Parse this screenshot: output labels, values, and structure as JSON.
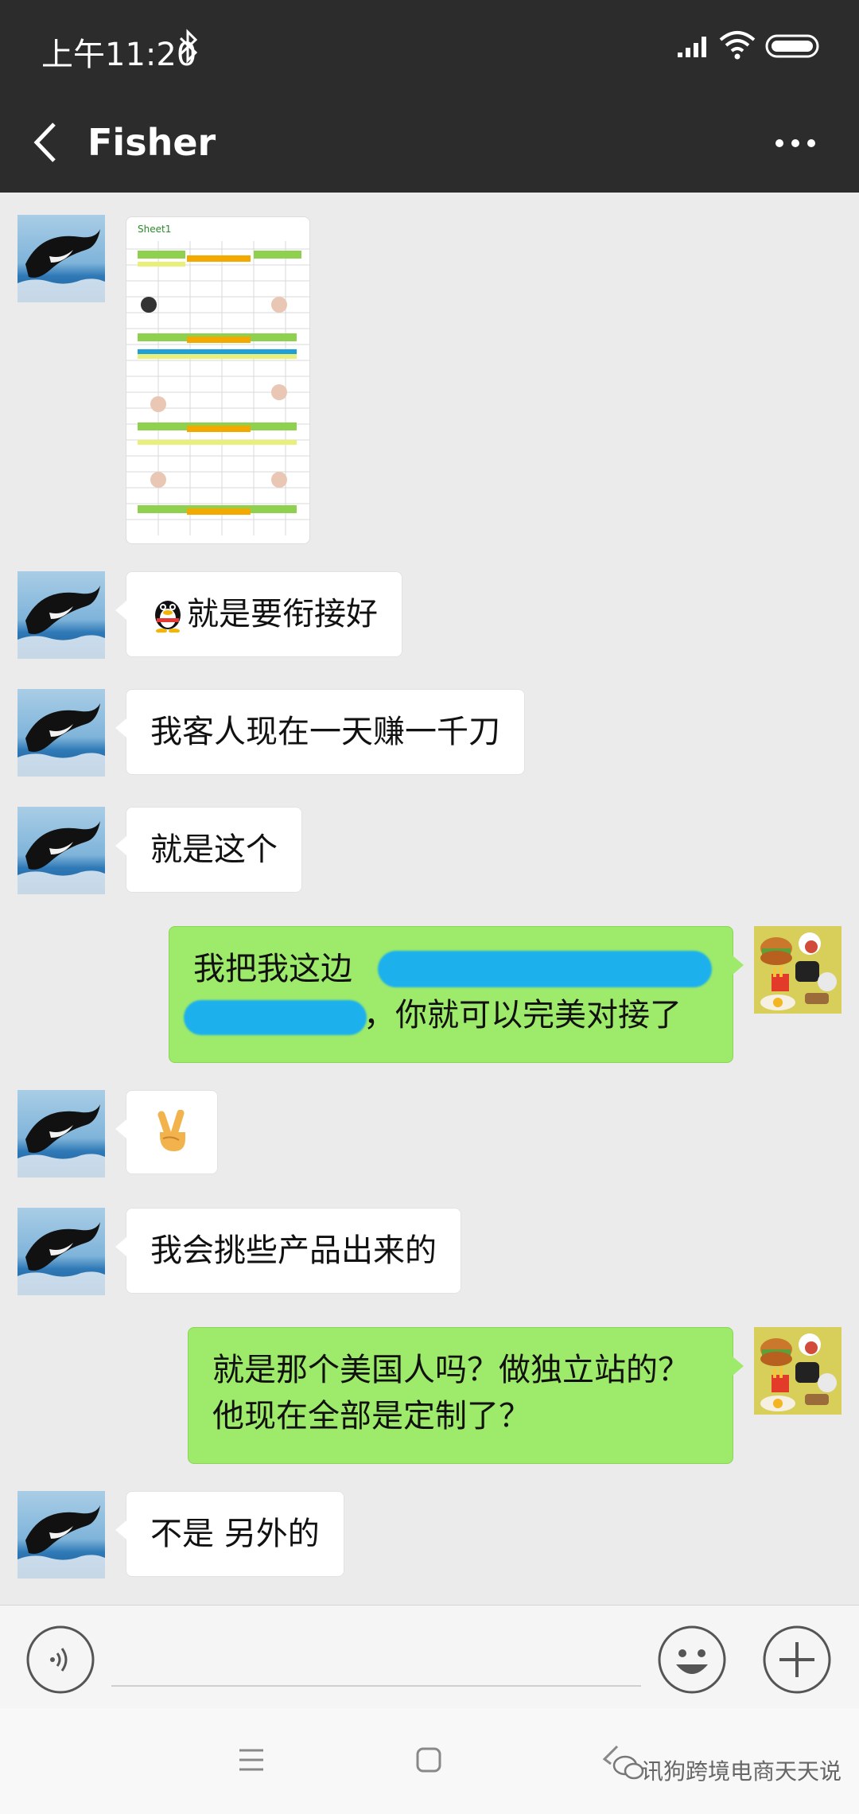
{
  "status_bar": {
    "time": "上午11:20"
  },
  "title_bar": {
    "title": "Fisher"
  },
  "image_message": {
    "sheet_label": "Sheet1"
  },
  "messages": [
    {
      "side": "left",
      "text": "就是要衔接好",
      "emoji": "qq-penguin-icon"
    },
    {
      "side": "left",
      "text": "我客人现在一天赚一千刀"
    },
    {
      "side": "left",
      "text": "就是这个"
    },
    {
      "side": "right",
      "line1": "我把我这边",
      "line2_end": "，你就可以完美对接了"
    },
    {
      "side": "left",
      "emoji": "victory-hand-icon"
    },
    {
      "side": "left",
      "text": "我会挑些产品出来的"
    },
    {
      "side": "right",
      "line1": "就是那个美国人吗？做独立站的？",
      "line2": "他现在全部是定制了？"
    },
    {
      "side": "left",
      "text": "不是 另外的"
    }
  ],
  "input_bar": {
    "placeholder": ""
  },
  "watermark": {
    "text": "讯狗跨境电商天天说"
  },
  "colors": {
    "header": "#2c2c2c",
    "chat_bg": "#ebebeb",
    "sent_bubble": "#9eea6a",
    "received_bubble": "#ffffff"
  }
}
